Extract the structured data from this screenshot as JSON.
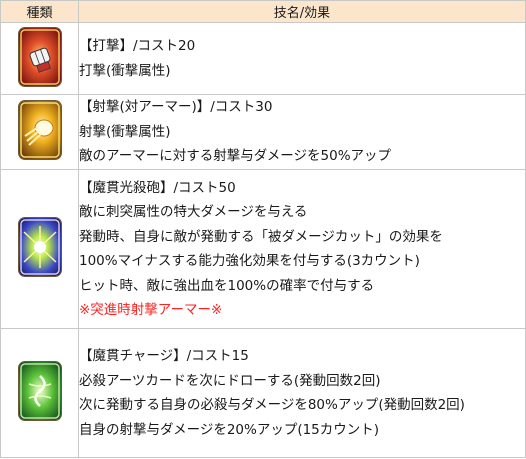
{
  "table": {
    "headers": {
      "type": "種類",
      "name_effect": "技名/効果"
    },
    "rows": [
      {
        "icon": "fist-strike-card-icon",
        "lines": [
          "【打撃】/コスト20",
          "打撃(衝撃属性)"
        ]
      },
      {
        "icon": "shooting-card-icon",
        "lines": [
          "【射撃(対アーマー)】/コスト30",
          "射撃(衝撃属性)",
          "敵のアーマーに対する射撃与ダメージを50%アップ"
        ]
      },
      {
        "icon": "burst-cannon-card-icon",
        "lines": [
          "【魔貫光殺砲】/コスト50",
          "敵に刺突属性の特大ダメージを与える",
          "発動時、自身に敵が発動する「被ダメージカット」の効果を",
          "100%マイナスする能力強化効果を付与する(3カウント)",
          "ヒット時、敵に強出血を100%の確率で付与する"
        ],
        "note": "※突進時射撃アーマー※"
      },
      {
        "icon": "charge-card-icon",
        "lines": [
          "【魔貫チャージ】/コスト15",
          "必殺アーツカードを次にドローする(発動回数2回)",
          "次に発動する自身の必殺与ダメージを80%アップ(発動回数2回)",
          "自身の射撃与ダメージを20%アップ(15カウント)"
        ]
      }
    ]
  },
  "colors": {
    "header_bg": "#fbe6cc",
    "border": "#c8c8c8",
    "note_red": "#ff2020"
  }
}
